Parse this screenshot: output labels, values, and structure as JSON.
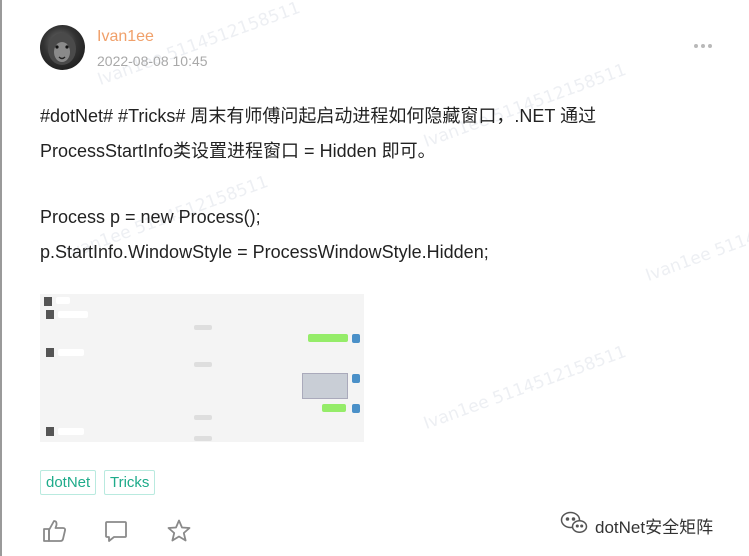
{
  "post": {
    "username": "Ivan1ee",
    "timestamp": "2022-08-08 10:45",
    "lines": [
      "#dotNet# #Tricks#  周末有师傅问起启动进程如何隐藏窗口，.NET 通过",
      "ProcessStartInfo类设置进程窗口 = Hidden  即可。",
      "Process p = new Process();",
      "p.StartInfo.WindowStyle = ProcessWindowStyle.Hidden;"
    ]
  },
  "tags": [
    "dotNet",
    "Tricks"
  ],
  "actions": {
    "like_icon": "thumbs-up-icon",
    "comment_icon": "comment-icon",
    "favorite_icon": "star-icon"
  },
  "brand": {
    "name": "dotNet安全矩阵",
    "icon": "wechat-icon"
  },
  "watermark": {
    "text": "Ivan1ee 5114512158511"
  },
  "colors": {
    "username": "#f0a06a",
    "tag_text": "#1eab8a",
    "tag_border": "#b9eadf"
  }
}
